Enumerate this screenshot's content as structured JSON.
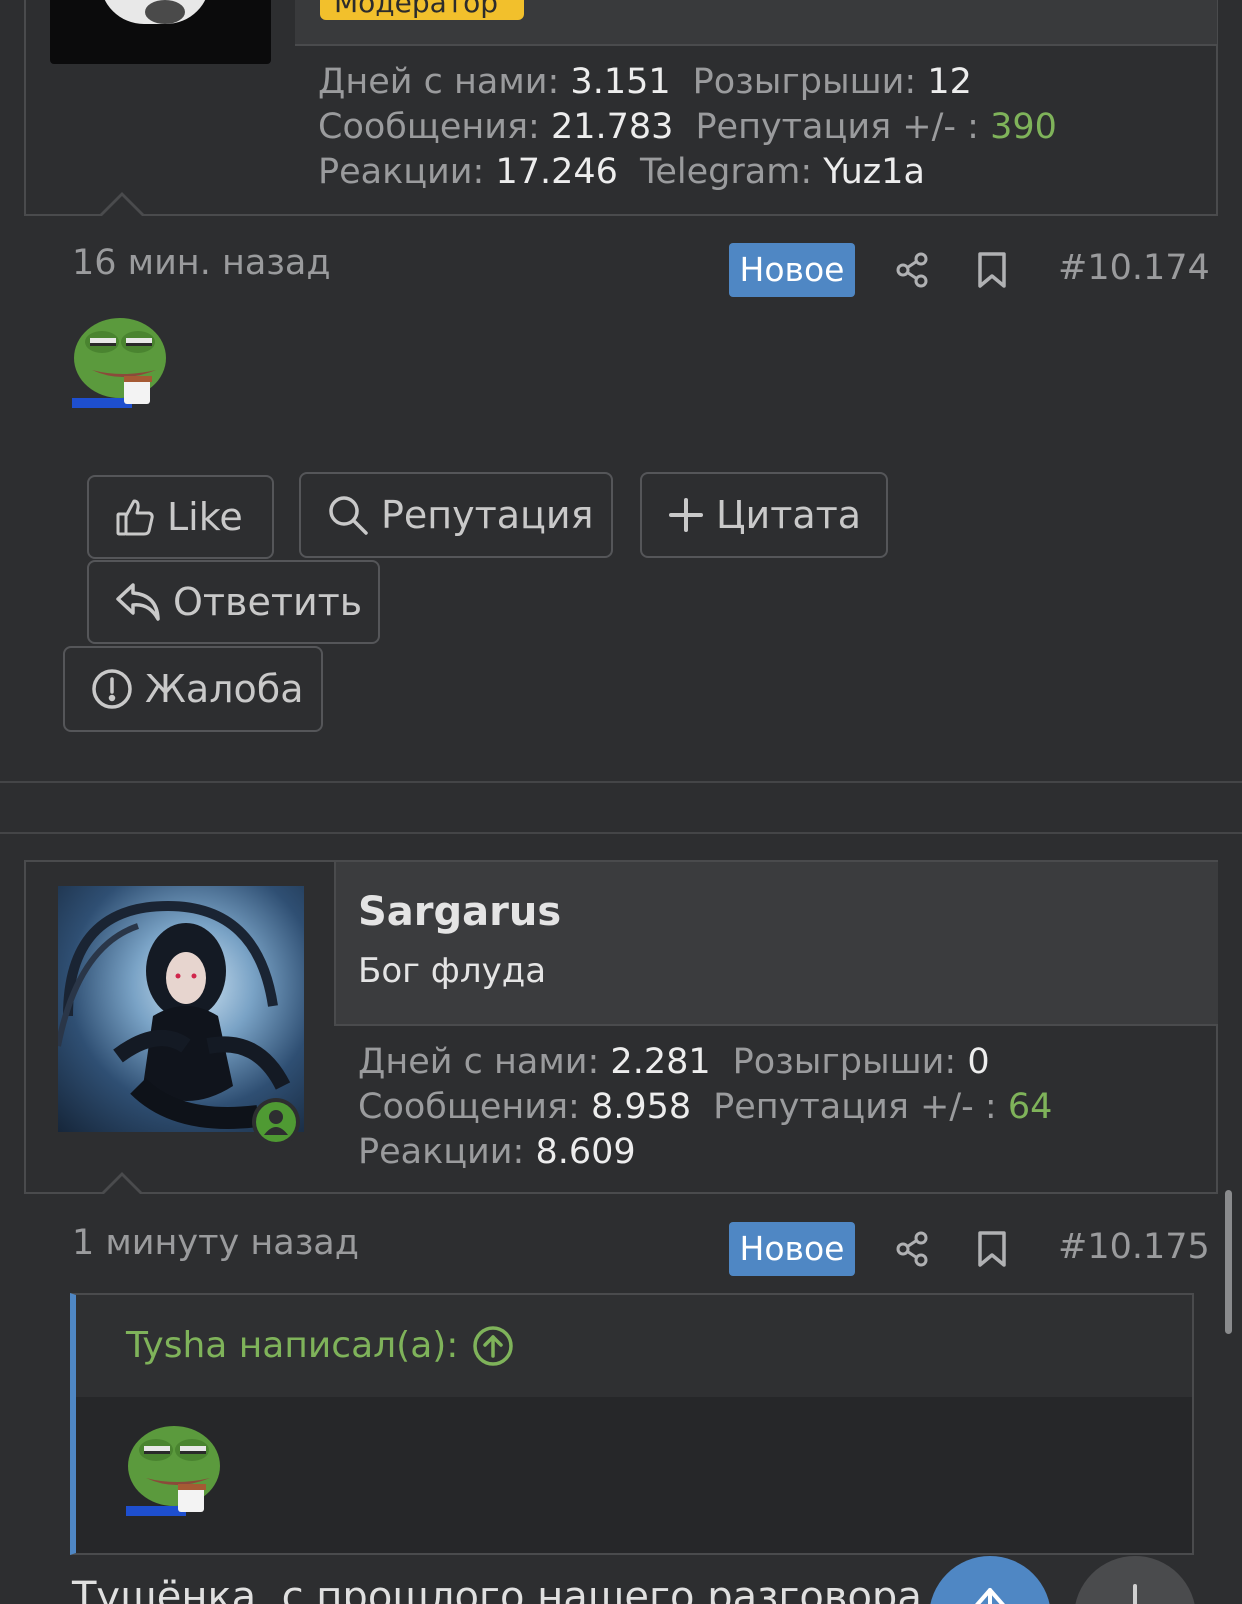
{
  "post1": {
    "role_badge": "Модератор",
    "stats": {
      "days_label": "Дней с нами:",
      "days_value": "3.151",
      "giveaways_label": "Розыгрыши:",
      "giveaways_value": "12",
      "messages_label": "Сообщения:",
      "messages_value": "21.783",
      "reputation_label": "Репутация +/- :",
      "reputation_value": "390",
      "reactions_label": "Реакции:",
      "reactions_value": "17.246",
      "telegram_label": "Telegram:",
      "telegram_value": "Yuz1a"
    },
    "time": "16 мин. назад",
    "new_badge": "Новое",
    "post_number": "#10.174",
    "buttons": {
      "like": "Like",
      "reputation": "Репутация",
      "quote": "Цитата",
      "reply": "Ответить",
      "report": "Жалоба"
    }
  },
  "post2": {
    "username": "Sargarus",
    "user_title": "Бог флуда",
    "stats": {
      "days_label": "Дней с нами:",
      "days_value": "2.281",
      "giveaways_label": "Розыгрыши:",
      "giveaways_value": "0",
      "messages_label": "Сообщения:",
      "messages_value": "8.958",
      "reputation_label": "Репутация +/- :",
      "reputation_value": "64",
      "reactions_label": "Реакции:",
      "reactions_value": "8.609"
    },
    "time": "1 минуту назад",
    "new_badge": "Новое",
    "post_number": "#10.175",
    "quote_author": "Tysha написал(а):",
    "body_text": "Тушёнка, с прошлого нашего разговора о"
  },
  "colors": {
    "background": "#2d2e30",
    "accent_blue": "#4f87c4",
    "reputation_green": "#7fb35a",
    "moderator_yellow": "#f2c02c"
  },
  "icons": [
    "share-icon",
    "bookmark-icon",
    "like-icon",
    "search-icon",
    "plus-icon",
    "reply-icon",
    "alert-icon",
    "arrow-up-circle-icon",
    "user-online-icon"
  ]
}
